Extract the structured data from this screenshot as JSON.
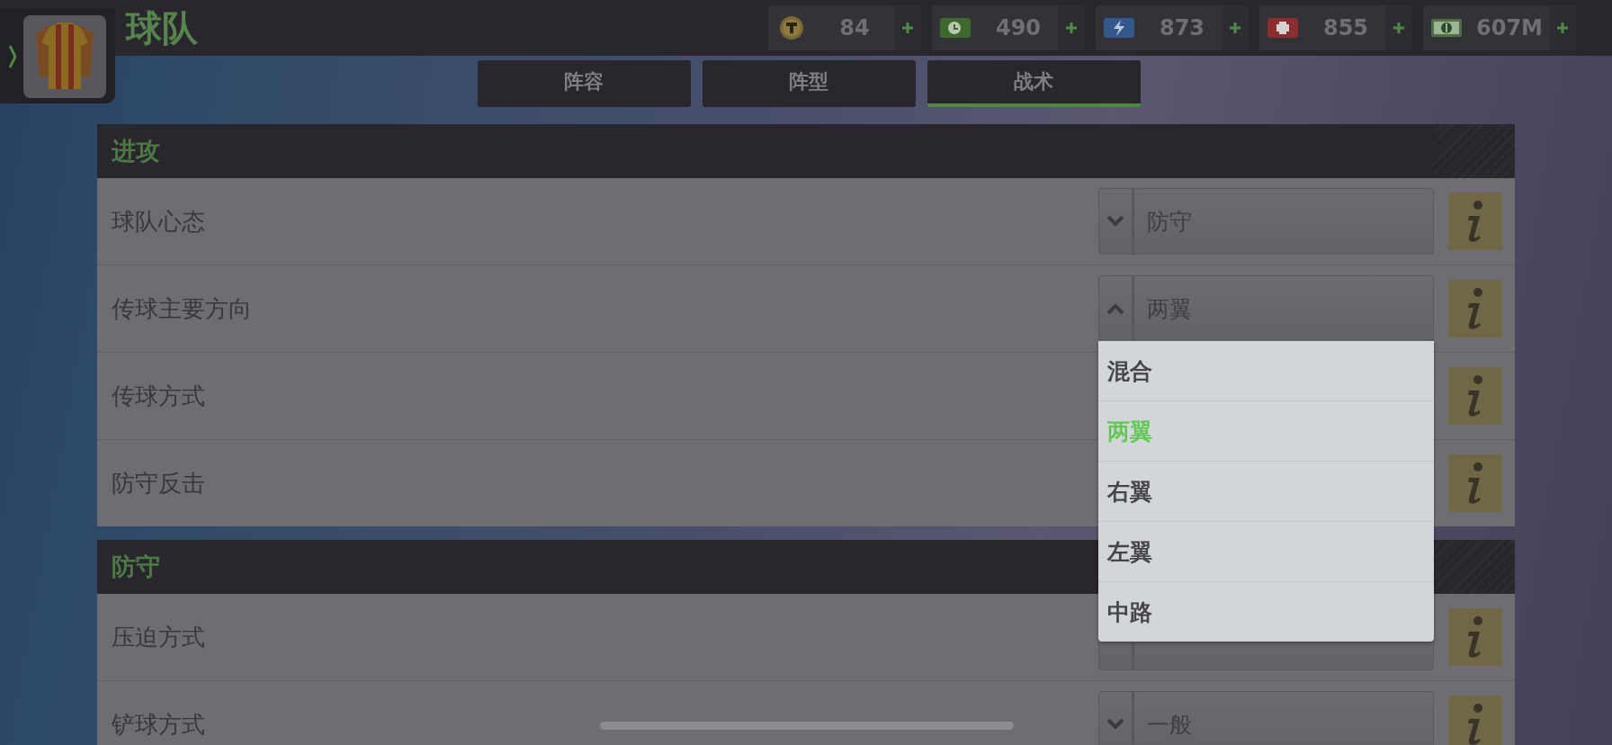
{
  "header": {
    "title": "球队"
  },
  "currencies": [
    {
      "kind": "token",
      "amount": "84"
    },
    {
      "kind": "cash-clock",
      "amount": "490"
    },
    {
      "kind": "energy",
      "amount": "873"
    },
    {
      "kind": "medical",
      "amount": "855"
    },
    {
      "kind": "cash",
      "amount": "607M"
    }
  ],
  "tabs": [
    {
      "label": "阵容",
      "selected": false
    },
    {
      "label": "阵型",
      "selected": false
    },
    {
      "label": "战术",
      "selected": true
    }
  ],
  "sections": [
    {
      "title": "进攻",
      "rows": [
        {
          "label": "球队心态",
          "select": true,
          "value": "防守",
          "expanded": false
        },
        {
          "label": "传球主要方向",
          "select": true,
          "value": "两翼",
          "expanded": true,
          "options": [
            {
              "label": "混合",
              "selected": false
            },
            {
              "label": "两翼",
              "selected": true
            },
            {
              "label": "右翼",
              "selected": false
            },
            {
              "label": "左翼",
              "selected": false
            },
            {
              "label": "中路",
              "selected": false
            }
          ]
        },
        {
          "label": "传球方式"
        },
        {
          "label": "防守反击"
        }
      ]
    },
    {
      "title": "防守",
      "rows": [
        {
          "label": "压迫方式",
          "select": true
        },
        {
          "label": "铲球方式",
          "select": true,
          "value": "一般",
          "expanded": false
        }
      ]
    }
  ]
}
